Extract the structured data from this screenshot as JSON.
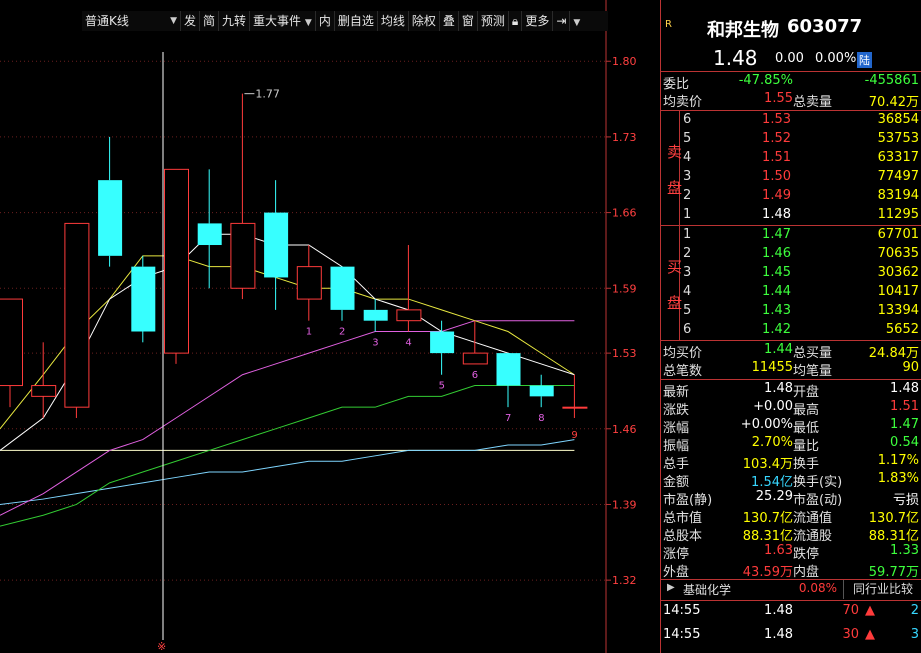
{
  "toolbar": {
    "chart_type": "普通K线",
    "items": [
      "发",
      "简",
      "九转",
      "重大事件",
      "内",
      "删自选",
      "均线",
      "除权",
      "叠",
      "窗",
      "预测",
      "锁",
      "更多"
    ]
  },
  "chart_data": {
    "type": "candlestick",
    "y_ticks": [
      1.8,
      1.73,
      1.66,
      1.59,
      1.53,
      1.46,
      1.39,
      1.32
    ],
    "ylim": [
      1.26,
      1.84
    ],
    "candles": [
      {
        "o": 1.5,
        "c": 1.58,
        "h": 1.58,
        "l": 1.48
      },
      {
        "o": 1.49,
        "c": 1.5,
        "h": 1.54,
        "l": 1.47
      },
      {
        "o": 1.48,
        "c": 1.65,
        "h": 1.65,
        "l": 1.47
      },
      {
        "o": 1.69,
        "c": 1.62,
        "h": 1.73,
        "l": 1.61
      },
      {
        "o": 1.61,
        "c": 1.55,
        "h": 1.62,
        "l": 1.54
      },
      {
        "o": 1.53,
        "c": 1.7,
        "h": 1.7,
        "l": 1.52
      },
      {
        "o": 1.65,
        "c": 1.63,
        "h": 1.7,
        "l": 1.59
      },
      {
        "o": 1.59,
        "c": 1.65,
        "h": 1.77,
        "l": 1.58
      },
      {
        "o": 1.66,
        "c": 1.6,
        "h": 1.69,
        "l": 1.57
      },
      {
        "o": 1.58,
        "c": 1.61,
        "h": 1.63,
        "l": 1.56
      },
      {
        "o": 1.61,
        "c": 1.57,
        "h": 1.61,
        "l": 1.56
      },
      {
        "o": 1.57,
        "c": 1.56,
        "h": 1.58,
        "l": 1.55
      },
      {
        "o": 1.56,
        "c": 1.57,
        "h": 1.63,
        "l": 1.55
      },
      {
        "o": 1.55,
        "c": 1.53,
        "h": 1.56,
        "l": 1.51
      },
      {
        "o": 1.52,
        "c": 1.53,
        "h": 1.56,
        "l": 1.52
      },
      {
        "o": 1.53,
        "c": 1.5,
        "h": 1.53,
        "l": 1.48
      },
      {
        "o": 1.5,
        "c": 1.49,
        "h": 1.51,
        "l": 1.48
      },
      {
        "o": 1.48,
        "c": 1.48,
        "h": 1.51,
        "l": 1.47
      }
    ],
    "counters": [
      "1",
      "2",
      "3",
      "4",
      "5",
      "6",
      "7",
      "8",
      "9"
    ],
    "max_label": "1.77",
    "ma_yellow": [
      1.46,
      1.51,
      1.55,
      1.58,
      1.62,
      1.62,
      1.61,
      1.61,
      1.6,
      1.59,
      1.59,
      1.58,
      1.58,
      1.57,
      1.56,
      1.55,
      1.53,
      1.51
    ],
    "ma_white": [
      1.44,
      1.47,
      1.52,
      1.58,
      1.6,
      1.61,
      1.64,
      1.64,
      1.63,
      1.63,
      1.61,
      1.58,
      1.57,
      1.55,
      1.54,
      1.53,
      1.52,
      1.51
    ],
    "ma_purple": [
      1.38,
      1.4,
      1.42,
      1.44,
      1.45,
      1.47,
      1.49,
      1.51,
      1.52,
      1.53,
      1.54,
      1.55,
      1.55,
      1.55,
      1.56,
      1.56,
      1.56,
      1.56
    ],
    "ma_green": [
      1.37,
      1.38,
      1.39,
      1.41,
      1.42,
      1.43,
      1.44,
      1.45,
      1.46,
      1.47,
      1.48,
      1.48,
      1.49,
      1.49,
      1.5,
      1.5,
      1.5,
      1.5
    ],
    "ma_cyan": [
      1.39,
      1.395,
      1.4,
      1.405,
      1.41,
      1.415,
      1.42,
      1.42,
      1.425,
      1.43,
      1.43,
      1.435,
      1.44,
      1.44,
      1.44,
      1.445,
      1.445,
      1.45
    ],
    "ma_lightyellow": [
      1.44,
      1.44,
      1.44,
      1.44,
      1.44,
      1.44,
      1.44,
      1.44,
      1.44,
      1.44,
      1.44,
      1.44,
      1.44,
      1.44,
      1.44,
      1.44,
      1.44,
      1.44
    ]
  },
  "panel": {
    "tag": "R",
    "name": "和邦生物",
    "code": "603077",
    "price": "1.48",
    "change": "0.00",
    "change_pct": "0.00%",
    "badge": "陆",
    "weibi_label": "委比",
    "weibi_pct": "-47.85%",
    "weibi_val": "-455861",
    "avg_sell_label": "均卖价",
    "avg_sell": "1.55",
    "total_sell_label": "总卖量",
    "total_sell": "70.42万",
    "sell_side_top": "卖",
    "sell_side_bottom": "盘",
    "sells": [
      {
        "n": "6",
        "p": "1.53",
        "v": "36854"
      },
      {
        "n": "5",
        "p": "1.52",
        "v": "53753"
      },
      {
        "n": "4",
        "p": "1.51",
        "v": "63317"
      },
      {
        "n": "3",
        "p": "1.50",
        "v": "77497"
      },
      {
        "n": "2",
        "p": "1.49",
        "v": "83194"
      },
      {
        "n": "1",
        "p": "1.48",
        "v": "11295"
      }
    ],
    "buy_side_top": "买",
    "buy_side_bottom": "盘",
    "buys": [
      {
        "n": "1",
        "p": "1.47",
        "v": "67701"
      },
      {
        "n": "2",
        "p": "1.46",
        "v": "70635"
      },
      {
        "n": "3",
        "p": "1.45",
        "v": "30362"
      },
      {
        "n": "4",
        "p": "1.44",
        "v": "10417"
      },
      {
        "n": "5",
        "p": "1.43",
        "v": "13394"
      },
      {
        "n": "6",
        "p": "1.42",
        "v": "5652"
      }
    ],
    "avg_buy_label": "均买价",
    "avg_buy": "1.44",
    "total_buy_label": "总买量",
    "total_buy": "24.84万",
    "total_trades_label": "总笔数",
    "total_trades": "11455",
    "avg_trade_label": "均笔量",
    "avg_trade": "90",
    "stats": [
      {
        "l1": "最新",
        "v1": "1.48",
        "c1": "white",
        "l2": "开盘",
        "v2": "1.48",
        "c2": "white"
      },
      {
        "l1": "涨跌",
        "v1": "+0.00",
        "c1": "white",
        "l2": "最高",
        "v2": "1.51",
        "c2": "red"
      },
      {
        "l1": "涨幅",
        "v1": "+0.00%",
        "c1": "white",
        "l2": "最低",
        "v2": "1.47",
        "c2": "green"
      },
      {
        "l1": "振幅",
        "v1": "2.70%",
        "c1": "yellow",
        "l2": "量比",
        "v2": "0.54",
        "c2": "green"
      },
      {
        "l1": "总手",
        "v1": "103.4万",
        "c1": "yellow",
        "l2": "换手",
        "v2": "1.17%",
        "c2": "yellow"
      },
      {
        "l1": "金额",
        "v1": "1.54亿",
        "c1": "cyan",
        "l2": "换手(实)",
        "v2": "1.83%",
        "c2": "yellow"
      },
      {
        "l1": "市盈(静)",
        "v1": "25.29",
        "c1": "white",
        "l2": "市盈(动)",
        "v2": "亏损",
        "c2": "white"
      },
      {
        "l1": "总市值",
        "v1": "130.7亿",
        "c1": "yellow",
        "l2": "流通值",
        "v2": "130.7亿",
        "c2": "yellow"
      },
      {
        "l1": "总股本",
        "v1": "88.31亿",
        "c1": "yellow",
        "l2": "流通股",
        "v2": "88.31亿",
        "c2": "yellow"
      },
      {
        "l1": "涨停",
        "v1": "1.63",
        "c1": "red",
        "l2": "跌停",
        "v2": "1.33",
        "c2": "green"
      },
      {
        "l1": "外盘",
        "v1": "43.59万",
        "c1": "red",
        "l2": "内盘",
        "v2": "59.77万",
        "c2": "green"
      }
    ],
    "industry": "基础化学",
    "industry_pct": "0.08%",
    "peer_button": "同行业比较",
    "ticks": [
      {
        "t": "14:55",
        "p": "1.48",
        "v": "70",
        "extra": "2"
      },
      {
        "t": "14:55",
        "p": "1.48",
        "v": "30",
        "extra": "3"
      }
    ],
    "colors": {
      "up": "#ff3b3b",
      "down": "#37ffff",
      "border": "#b33",
      "bg": "#000"
    }
  }
}
